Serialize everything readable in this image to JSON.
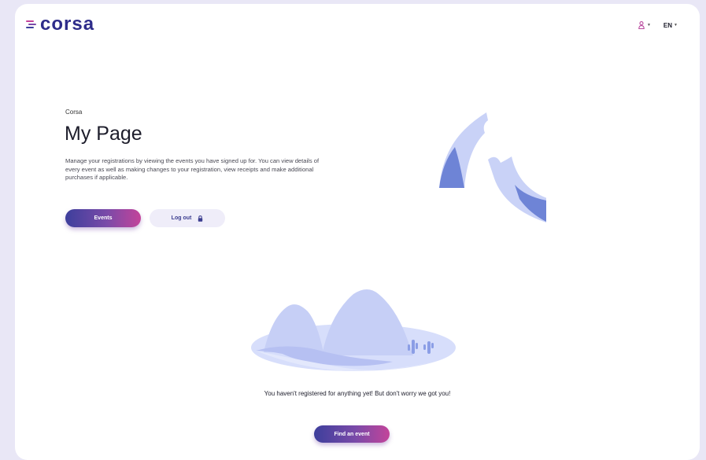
{
  "header": {
    "logo_text": "corsa",
    "language": "EN"
  },
  "hero": {
    "breadcrumb": "Corsa",
    "title": "My Page",
    "description": "Manage your registrations by viewing the events you have signed up for. You can view details of every event as well as making changes to your registration, view receipts and make additional purchases if applicable.",
    "events_button": "Events",
    "logout_button": "Log out"
  },
  "empty_state": {
    "message": "You haven't registered for anything yet! But don't worry we got you!",
    "find_button": "Find an event"
  },
  "colors": {
    "brand": "#2e2c8a",
    "accent_gradient_start": "#3d3f9c",
    "accent_gradient_end": "#c3449a",
    "illustration_light": "#c9d2f7",
    "illustration_dark": "#6e84d6"
  }
}
